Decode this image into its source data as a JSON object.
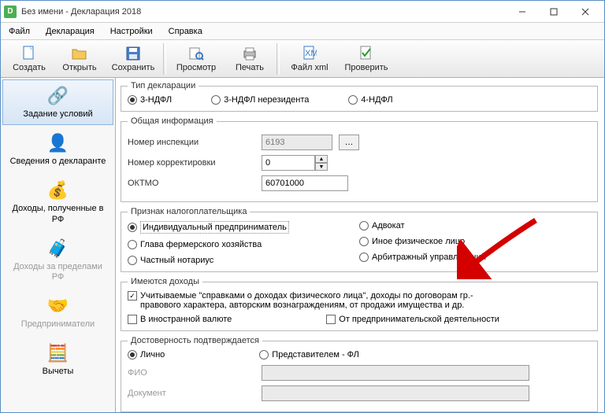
{
  "window": {
    "title": "Без имени - Декларация 2018"
  },
  "menu": {
    "file": "Файл",
    "decl": "Декларация",
    "settings": "Настройки",
    "help": "Справка"
  },
  "toolbar": {
    "create": "Создать",
    "open": "Открыть",
    "save": "Сохранить",
    "preview": "Просмотр",
    "print": "Печать",
    "xml": "Файл xml",
    "check": "Проверить"
  },
  "sidebar": {
    "conditions": "Задание условий",
    "declarant": "Сведения о декларанте",
    "income_rf": "Доходы, полученные в РФ",
    "income_foreign": "Доходы за пределами РФ",
    "entrepreneurs": "Предприниматели",
    "deductions": "Вычеты"
  },
  "groups": {
    "decl_type": "Тип декларации",
    "general": "Общая информация",
    "taxpayer": "Признак налогоплательщика",
    "income": "Имеются доходы",
    "confirm": "Достоверность подтверждается"
  },
  "decl_type": {
    "ndfl3": "3-НДФЛ",
    "ndfl3_nr": "3-НДФЛ нерезидента",
    "ndfl4": "4-НДФЛ"
  },
  "general": {
    "inspection": "Номер инспекции",
    "inspection_val": "6193",
    "correction": "Номер корректировки",
    "correction_val": "0",
    "oktmo": "ОКТМО",
    "oktmo_val": "60701000"
  },
  "taxpayer": {
    "ip": "Индивидуальный предприниматель",
    "farm": "Глава фермерского хозяйства",
    "notary": "Частный нотариус",
    "lawyer": "Адвокат",
    "other": "Иное физическое лицо",
    "arbitr": "Арбитражный управляющий"
  },
  "income": {
    "spravka": "Учитываемые \"справками о доходах физического лица\", доходы по договорам гр.-правового характера, авторским вознаграждениям, от продажи имущества и др.",
    "foreign": "В иностранной валюте",
    "business": "От предпринимательской деятельности"
  },
  "confirm": {
    "personal": "Лично",
    "rep": "Представителем - ФЛ",
    "fio": "ФИО",
    "doc": "Документ"
  }
}
